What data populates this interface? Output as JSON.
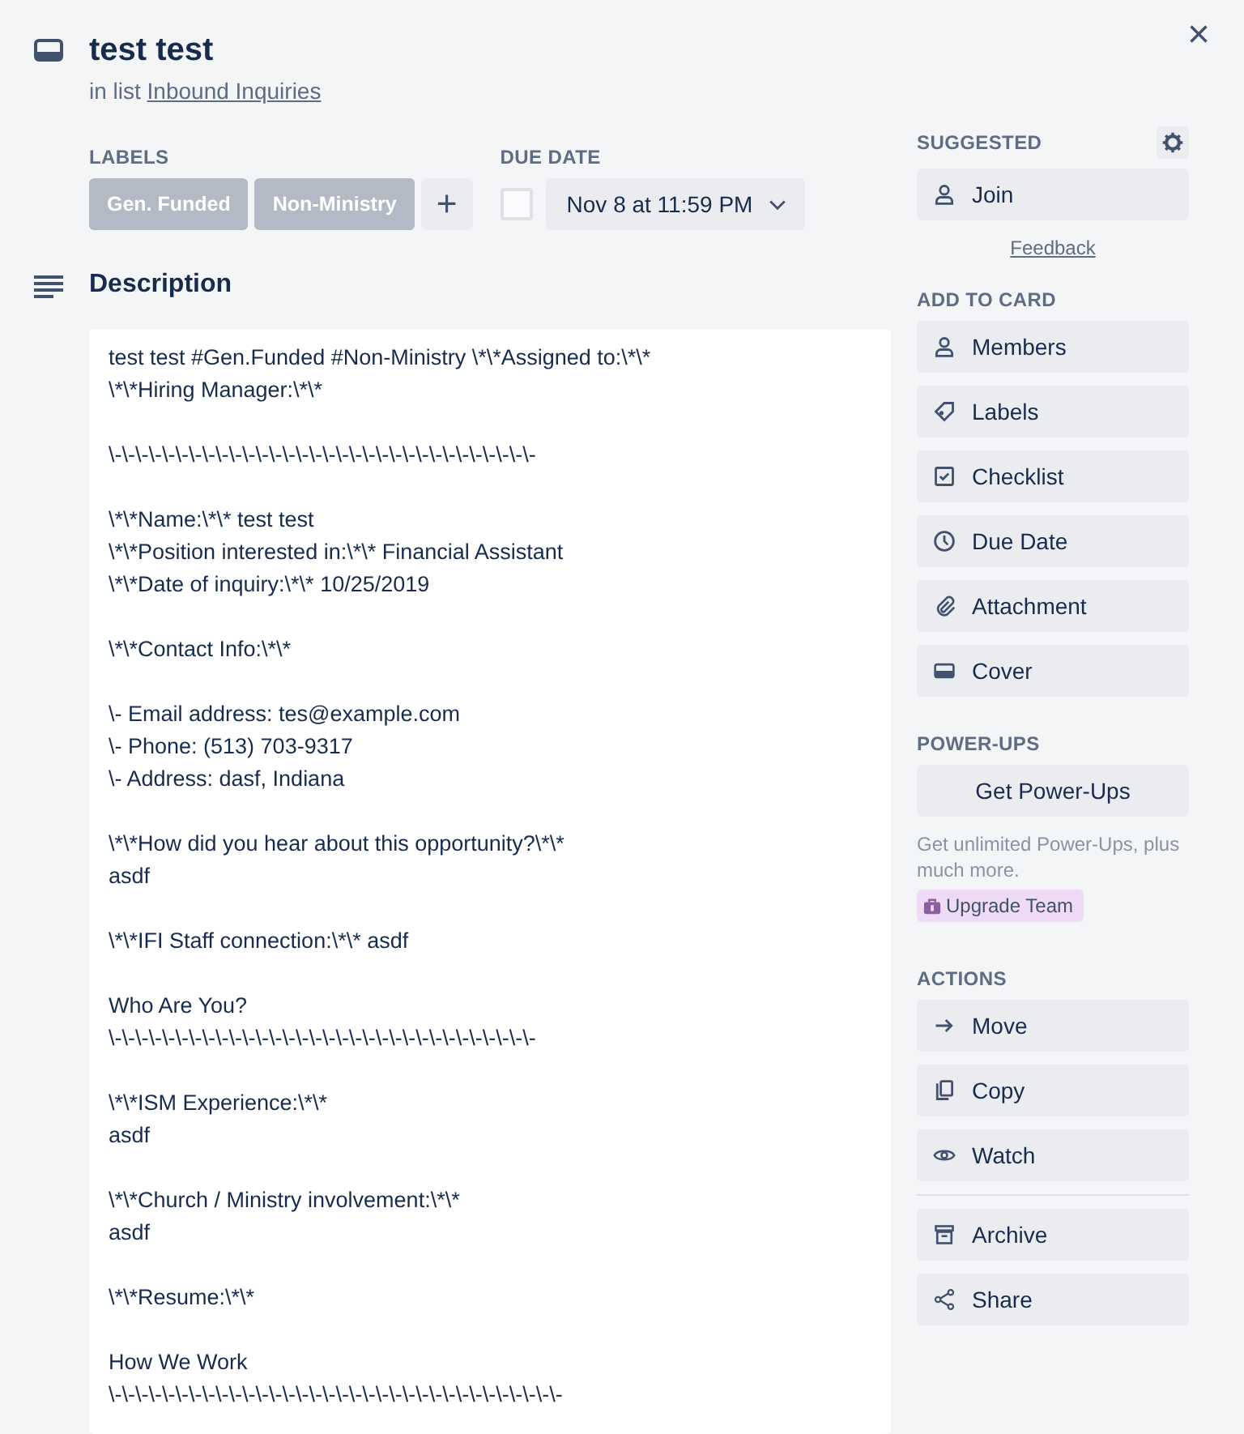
{
  "card": {
    "title": "test test",
    "list_prefix": "in list",
    "list_name": "Inbound Inquiries",
    "close": "×"
  },
  "labels": {
    "heading": "LABELS",
    "items": [
      {
        "text": "Gen. Funded"
      },
      {
        "text": "Non-Ministry"
      }
    ],
    "add": "+"
  },
  "due_date": {
    "heading": "DUE DATE",
    "checked": false,
    "value": "Nov 8 at 11:59 PM"
  },
  "description": {
    "heading": "Description",
    "paragraphs": [
      [
        "test test #Gen.Funded #Non-Ministry \\*\\*Assigned to:\\*\\*",
        "\\*\\*Hiring Manager:\\*\\*"
      ],
      [
        "\\-\\-\\-\\-\\-\\-\\-\\-\\-\\-\\-\\-\\-\\-\\-\\-\\-\\-\\-\\-\\-\\-\\-\\-\\-\\-\\-\\-\\-\\-\\-\\-"
      ],
      [
        "\\*\\*Name:\\*\\* test test",
        "\\*\\*Position interested in:\\*\\* Financial Assistant",
        "\\*\\*Date of inquiry:\\*\\* 10/25/2019"
      ],
      [
        "\\*\\*Contact Info:\\*\\*"
      ],
      [
        "\\- Email address: tes@example.com",
        "\\- Phone: (513) 703-9317",
        "\\- Address: dasf, Indiana"
      ],
      [
        "\\*\\*How did you hear about this opportunity?\\*\\*",
        "asdf"
      ],
      [
        "\\*\\*IFI Staff connection:\\*\\* asdf"
      ],
      [
        "Who Are You?",
        "\\-\\-\\-\\-\\-\\-\\-\\-\\-\\-\\-\\-\\-\\-\\-\\-\\-\\-\\-\\-\\-\\-\\-\\-\\-\\-\\-\\-\\-\\-\\-\\-"
      ],
      [
        "\\*\\*ISM Experience:\\*\\*",
        "asdf"
      ],
      [
        "\\*\\*Church / Ministry involvement:\\*\\*",
        "asdf"
      ],
      [
        "\\*\\*Resume:\\*\\*"
      ],
      [
        "How We Work",
        "\\-\\-\\-\\-\\-\\-\\-\\-\\-\\-\\-\\-\\-\\-\\-\\-\\-\\-\\-\\-\\-\\-\\-\\-\\-\\-\\-\\-\\-\\-\\-\\-\\-\\-"
      ]
    ]
  },
  "suggested": {
    "heading": "SUGGESTED",
    "buttons": [
      "Join"
    ],
    "feedback": "Feedback"
  },
  "add_to_card": {
    "heading": "ADD TO CARD",
    "buttons": [
      "Members",
      "Labels",
      "Checklist",
      "Due Date",
      "Attachment",
      "Cover"
    ]
  },
  "power_ups": {
    "heading": "POWER-UPS",
    "button": "Get Power-Ups",
    "note": "Get unlimited Power-Ups, plus much more.",
    "upgrade": "Upgrade Team"
  },
  "actions": {
    "heading": "ACTIONS",
    "groups": [
      [
        "Move",
        "Copy",
        "Watch"
      ],
      [
        "Archive",
        "Share"
      ]
    ]
  }
}
